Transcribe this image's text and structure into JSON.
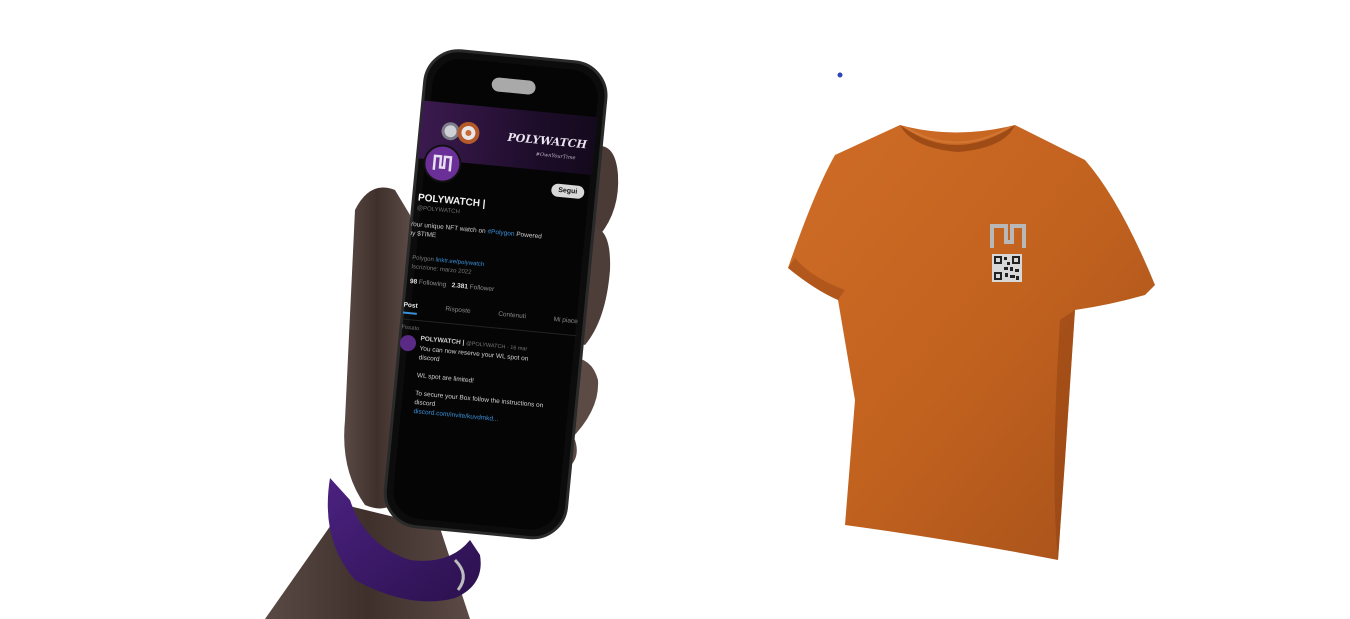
{
  "colors": {
    "shirt": "#c2621f",
    "shirt_shadow": "#8f3f12",
    "wristband": "#3d1a6b",
    "hand": "#4a3a36",
    "phone_body": "#0c0c0c",
    "brand_purple": "#5b2a86",
    "link_blue": "#3a8fd6"
  },
  "phone": {
    "banner_title": "POLYWATCH",
    "banner_tagline": "#OwnYourTime",
    "follow_button": "Segui",
    "profile_name": "POLYWATCH |",
    "profile_handle": "@POLYWATCH",
    "bio_line1": "Your unique NFT watch on",
    "bio_link": "#Polygon",
    "bio_line2": "Powered",
    "bio_line3": "by $TIME",
    "meta_location": "Polygon",
    "meta_link": "linktr.ee/polywatch",
    "meta_joined": "Iscrizione: marzo 2022",
    "stats_following_value": "98",
    "stats_following_label": "Following",
    "stats_followers_value": "2.381",
    "stats_followers_label": "Follower",
    "tabs": [
      "Post",
      "Risposte",
      "Contenuti",
      "Mi piace"
    ],
    "tweet_pinned": "Fissato",
    "tweet_author": "POLYWATCH |",
    "tweet_meta": "@POLYWATCH · 16 mar",
    "tweet_line1": "You can now reserve your WL spot on",
    "tweet_line2": "discord",
    "tweet_line3": "WL spot are limited!",
    "tweet_line4": "To secure your Box follow the instructions on",
    "tweet_line5": "discord",
    "tweet_link": "discord.com/invite/kuvdmkd..."
  },
  "shirt": {
    "logo_icon": "polywatch-logo-icon",
    "qr_icon": "qr-code-icon"
  }
}
